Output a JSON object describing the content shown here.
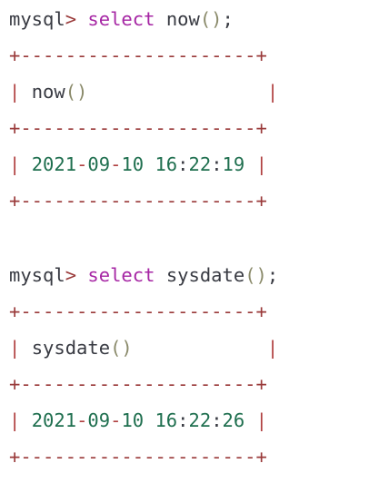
{
  "session": {
    "prompt": "mysql",
    "prompt_symbol": ">",
    "queries": [
      {
        "keyword": "select",
        "function": "now",
        "parens": "()",
        "terminator": ";",
        "border": "+---------------------+",
        "header_label": "now",
        "header_parens": "()",
        "result": {
          "year": "2021",
          "month": "09",
          "day": "10",
          "hour": "16",
          "minute": "22",
          "second": "19"
        }
      },
      {
        "keyword": "select",
        "function": "sysdate",
        "parens": "()",
        "terminator": ";",
        "border": "+---------------------+",
        "header_label": "sysdate",
        "header_parens": "()",
        "result": {
          "year": "2021",
          "month": "09",
          "day": "10",
          "hour": "16",
          "minute": "22",
          "second": "26"
        }
      }
    ],
    "colors": {
      "keyword": "#a626a4",
      "number": "#1f6f4f",
      "border": "#b04040",
      "text": "#383a42"
    }
  }
}
